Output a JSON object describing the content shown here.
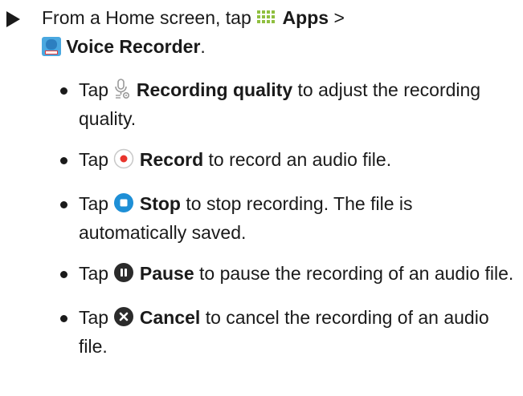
{
  "lead": {
    "prefix": "From a Home screen, tap",
    "apps_label": "Apps",
    "separator": ">",
    "app_label": "Voice Recorder",
    "suffix": "."
  },
  "steps": [
    {
      "tap": "Tap",
      "label": "Recording quality",
      "rest": "to adjust the recording quality.",
      "icon": "microphone-settings-icon"
    },
    {
      "tap": "Tap",
      "label": "Record",
      "rest": "to record an audio file.",
      "icon": "record-icon"
    },
    {
      "tap": "Tap",
      "label": "Stop",
      "rest": "to stop recording. The file is automatically saved.",
      "icon": "stop-icon"
    },
    {
      "tap": "Tap",
      "label": "Pause",
      "rest": "to pause the recording of an audio file.",
      "icon": "pause-icon"
    },
    {
      "tap": "Tap",
      "label": "Cancel",
      "rest": "to cancel the recording of an audio file.",
      "icon": "cancel-icon"
    }
  ],
  "colors": {
    "record_red": "#e8342c",
    "stop_blue": "#1e8fd6",
    "apps_green": "#8fbf3f",
    "text": "#1a1a1a"
  }
}
